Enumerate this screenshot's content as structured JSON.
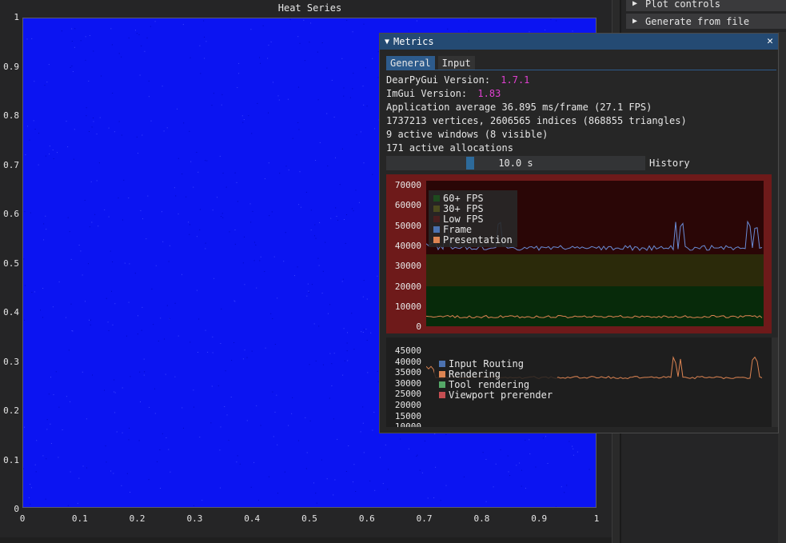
{
  "heat_plot": {
    "title": "Heat Series",
    "y_ticks": [
      "1",
      "0.9",
      "0.8",
      "0.7",
      "0.6",
      "0.5",
      "0.4",
      "0.3",
      "0.2",
      "0.1",
      "0"
    ],
    "x_ticks": [
      "0",
      "0.1",
      "0.2",
      "0.3",
      "0.4",
      "0.5",
      "0.6",
      "0.7",
      "0.8",
      "0.9",
      "1"
    ],
    "fill_color": "#0b14f2"
  },
  "side_panel": {
    "items": [
      {
        "label": "Plot controls",
        "icon": "triangle-right-icon"
      },
      {
        "label": "Generate from file",
        "icon": "triangle-right-icon"
      }
    ]
  },
  "metrics": {
    "title": "Metrics",
    "tabs": [
      {
        "label": "General"
      },
      {
        "label": "Input"
      }
    ],
    "dpg_version_label": "DearPyGui Version:",
    "dpg_version_value": "1.7.1",
    "imgui_version_label": "ImGui Version:",
    "imgui_version_value": "1.83",
    "app_average": "Application average 36.895 ms/frame (27.1 FPS)",
    "vertices": "1737213 vertices, 2606565 indices (868855 triangles)",
    "windows": "9 active windows (8 visible)",
    "allocations": "171 active allocations",
    "history_value": "10.0 s",
    "history_label": "History",
    "history_fraction": 0.32,
    "fps_plot": {
      "y_ticks": [
        "70000",
        "60000",
        "50000",
        "40000",
        "30000",
        "20000",
        "10000",
        "0"
      ],
      "legend": [
        {
          "label": "60+ FPS",
          "color": "#1e4a1e"
        },
        {
          "label": "30+ FPS",
          "color": "#4a4a1e"
        },
        {
          "label": "Low FPS",
          "color": "#4a1e1e"
        },
        {
          "label": "Frame",
          "color": "#4c72b0"
        },
        {
          "label": "Presentation",
          "color": "#dd8452"
        }
      ]
    },
    "timing_plot": {
      "y_ticks": [
        "45000",
        "40000",
        "35000",
        "30000",
        "25000",
        "20000",
        "15000",
        "10000"
      ],
      "legend": [
        {
          "label": "Input Routing",
          "color": "#4c72b0"
        },
        {
          "label": "Rendering",
          "color": "#dd8452"
        },
        {
          "label": "Tool rendering",
          "color": "#55a868"
        },
        {
          "label": "Viewport prerender",
          "color": "#c44e52"
        }
      ]
    }
  }
}
